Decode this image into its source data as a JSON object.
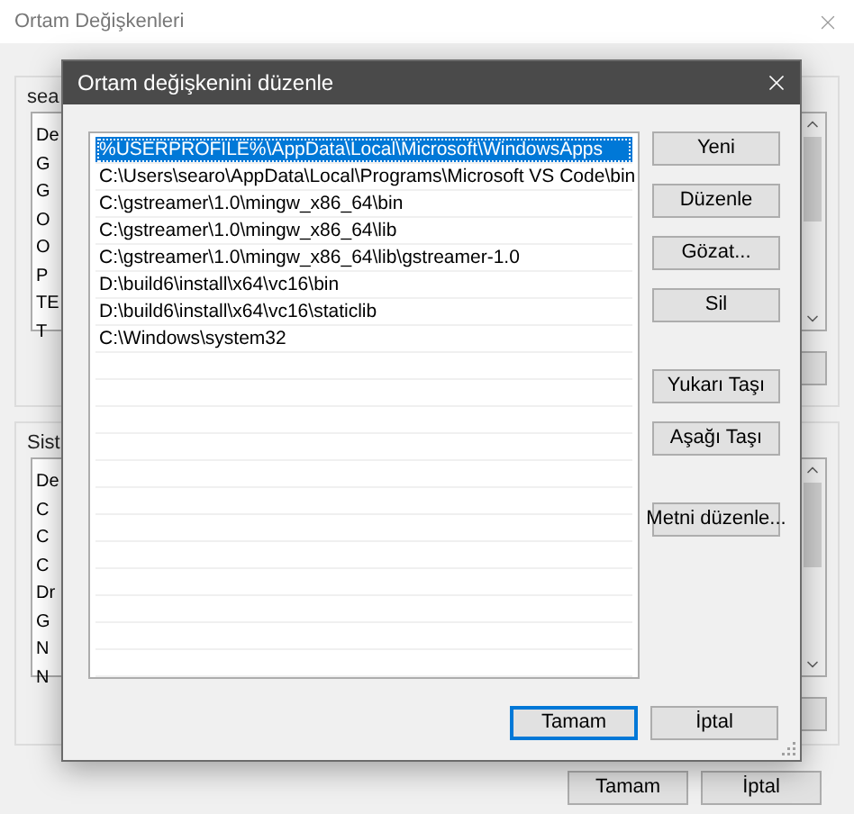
{
  "background_window": {
    "title": "Ortam Değişkenleri",
    "groups": [
      {
        "label": "sea",
        "items": [
          "De",
          "G",
          "G",
          "O",
          "O",
          "P",
          "TE",
          "T"
        ]
      },
      {
        "label": "Sist",
        "items": [
          "De",
          "C",
          "C",
          "C",
          "Dr",
          "G",
          "N",
          "N"
        ]
      }
    ],
    "buttons": [
      "Tamam",
      "İptal"
    ]
  },
  "dialog": {
    "title": "Ortam değişkenini düzenle",
    "paths": [
      {
        "text": "%USERPROFILE%\\AppData\\Local\\Microsoft\\WindowsApps",
        "selected": true
      },
      {
        "text": "C:\\Users\\searo\\AppData\\Local\\Programs\\Microsoft VS Code\\bin",
        "selected": false
      },
      {
        "text": "C:\\gstreamer\\1.0\\mingw_x86_64\\bin",
        "selected": false
      },
      {
        "text": "C:\\gstreamer\\1.0\\mingw_x86_64\\lib",
        "selected": false
      },
      {
        "text": "C:\\gstreamer\\1.0\\mingw_x86_64\\lib\\gstreamer-1.0",
        "selected": false
      },
      {
        "text": "D:\\build6\\install\\x64\\vc16\\bin",
        "selected": false
      },
      {
        "text": "D:\\build6\\install\\x64\\vc16\\staticlib",
        "selected": false
      },
      {
        "text": "C:\\Windows\\system32",
        "selected": false
      }
    ],
    "side_button_groups": [
      [
        "Yeni",
        "Düzenle",
        "Gözat...",
        "Sil"
      ],
      [
        "Yukarı Taşı",
        "Aşağı Taşı"
      ],
      [
        "Metni düzenle..."
      ]
    ],
    "footer_buttons": [
      {
        "label": "Tamam",
        "default": true
      },
      {
        "label": "İptal",
        "default": false
      }
    ]
  }
}
